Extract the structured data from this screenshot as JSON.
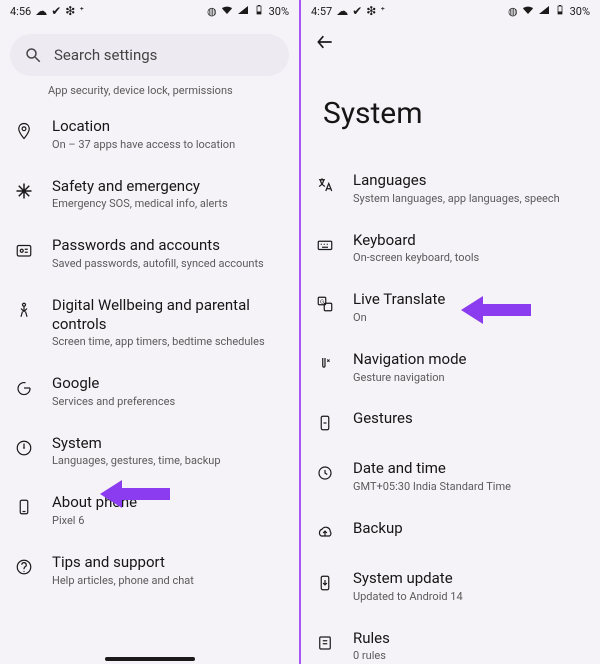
{
  "status_left": {
    "time_a": "4:56",
    "time_b": "4:57"
  },
  "status_right": {
    "battery": "30%"
  },
  "search": {
    "placeholder": "Search settings"
  },
  "truncated_subtitle": "App security, device lock, permissions",
  "settings_rows": {
    "location": {
      "title": "Location",
      "sub": "On – 37 apps have access to location"
    },
    "safety": {
      "title": "Safety and emergency",
      "sub": "Emergency SOS, medical info, alerts"
    },
    "passwords": {
      "title": "Passwords and accounts",
      "sub": "Saved passwords, autofill, synced accounts"
    },
    "wellbeing": {
      "title": "Digital Wellbeing and parental controls",
      "sub": "Screen time, app timers, bedtime schedules"
    },
    "google": {
      "title": "Google",
      "sub": "Services and preferences"
    },
    "system": {
      "title": "System",
      "sub": "Languages, gestures, time, backup"
    },
    "about": {
      "title": "About phone",
      "sub": "Pixel 6"
    },
    "tips": {
      "title": "Tips and support",
      "sub": "Help articles, phone and chat"
    }
  },
  "system_page": {
    "title": "System",
    "rows": {
      "languages": {
        "title": "Languages",
        "sub": "System languages, app languages, speech"
      },
      "keyboard": {
        "title": "Keyboard",
        "sub": "On-screen keyboard, tools"
      },
      "live_translate": {
        "title": "Live Translate",
        "sub": "On"
      },
      "nav_mode": {
        "title": "Navigation mode",
        "sub": "Gesture navigation"
      },
      "gestures": {
        "title": "Gestures",
        "sub": ""
      },
      "date_time": {
        "title": "Date and time",
        "sub": "GMT+05:30 India Standard Time"
      },
      "backup": {
        "title": "Backup",
        "sub": ""
      },
      "sys_update": {
        "title": "System update",
        "sub": "Updated to Android 14"
      },
      "rules": {
        "title": "Rules",
        "sub": "0 rules"
      }
    }
  },
  "annotation_color": "#8b3cf0"
}
